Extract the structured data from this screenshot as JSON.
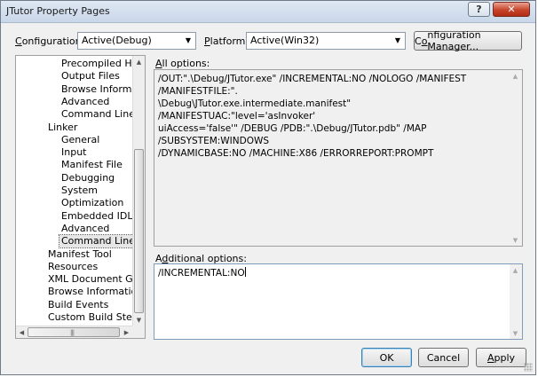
{
  "window": {
    "title": "JTutor Property Pages"
  },
  "title_buttons": {
    "help": "?",
    "close": "✕"
  },
  "config": {
    "label_prefix": "",
    "label_underlined": "C",
    "label_rest": "onfiguration:",
    "value": "Active(Debug)"
  },
  "platform": {
    "label_prefix": "",
    "label_underlined": "P",
    "label_rest": "latform:",
    "value": "Active(Win32)"
  },
  "config_manager": {
    "prefix": "C",
    "underlined": "o",
    "rest": "nfiguration Manager..."
  },
  "tree": {
    "items": [
      {
        "label": "Precompiled Heade",
        "level": 2
      },
      {
        "label": "Output Files",
        "level": 2
      },
      {
        "label": "Browse Information",
        "level": 2
      },
      {
        "label": "Advanced",
        "level": 2
      },
      {
        "label": "Command Line",
        "level": 2
      },
      {
        "label": "Linker",
        "level": 1
      },
      {
        "label": "General",
        "level": 2
      },
      {
        "label": "Input",
        "level": 2
      },
      {
        "label": "Manifest File",
        "level": 2
      },
      {
        "label": "Debugging",
        "level": 2
      },
      {
        "label": "System",
        "level": 2
      },
      {
        "label": "Optimization",
        "level": 2
      },
      {
        "label": "Embedded IDL",
        "level": 2
      },
      {
        "label": "Advanced",
        "level": 2
      },
      {
        "label": "Command Line",
        "level": 2,
        "selected": true
      },
      {
        "label": "Manifest Tool",
        "level": 1
      },
      {
        "label": "Resources",
        "level": 1
      },
      {
        "label": "XML Document Genera",
        "level": 1
      },
      {
        "label": "Browse Information",
        "level": 1
      },
      {
        "label": "Build Events",
        "level": 1
      },
      {
        "label": "Custom Build Step",
        "level": 1
      }
    ]
  },
  "all_options": {
    "label_prefix": "",
    "label_underlined": "A",
    "label_rest": "ll options:",
    "text": "/OUT:\".\\Debug/JTutor.exe\" /INCREMENTAL:NO /NOLOGO /MANIFEST /MANIFESTFILE:\".\n\\Debug\\JTutor.exe.intermediate.manifest\" /MANIFESTUAC:\"level='asInvoker'\nuiAccess='false'\" /DEBUG /PDB:\".\\Debug/JTutor.pdb\" /MAP /SUBSYSTEM:WINDOWS\n/DYNAMICBASE:NO /MACHINE:X86 /ERRORREPORT:PROMPT"
  },
  "additional_options": {
    "label_prefix": "A",
    "label_underlined": "d",
    "label_rest": "ditional options:",
    "value": "/INCREMENTAL:NO"
  },
  "buttons": {
    "ok": "OK",
    "cancel": "Cancel",
    "apply_underlined": "A",
    "apply_rest": "pply"
  }
}
